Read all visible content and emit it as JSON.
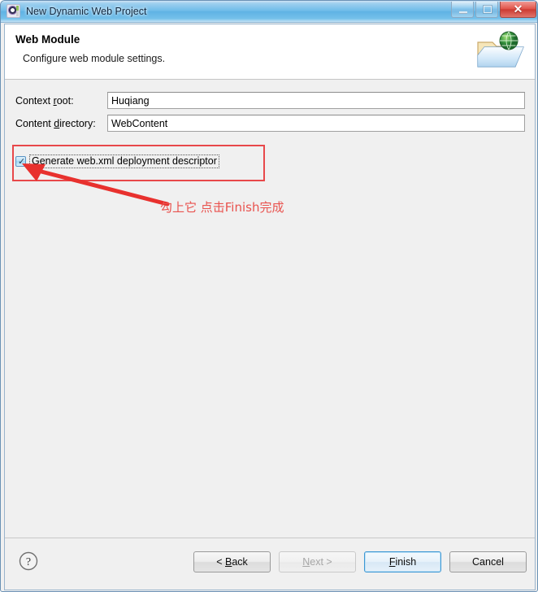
{
  "window": {
    "title": "New Dynamic Web Project",
    "icon": "eclipse-wizard-icon",
    "minimize_label": "Minimize",
    "maximize_label": "Maximize",
    "close_label": "Close",
    "close_glyph": "✕"
  },
  "header": {
    "title": "Web Module",
    "subtitle": "Configure web module settings.",
    "icon": "web-folder-globe-icon"
  },
  "form": {
    "context_root": {
      "label_pre": "Context ",
      "label_mnemonic": "r",
      "label_post": "oot:",
      "value": "Huqiang"
    },
    "content_directory": {
      "label_pre": "Content ",
      "label_mnemonic": "d",
      "label_post": "irectory:",
      "value": "WebContent"
    },
    "generate_webxml": {
      "label_pre": "",
      "label_mnemonic": "G",
      "label_post": "enerate web.xml deployment descriptor",
      "checked": true,
      "check_glyph": "✓"
    }
  },
  "annotation": {
    "text": "勾上它 点击Finish完成",
    "color": "#e9534f",
    "rect_color": "#e8484a",
    "arrow_color": "#e8312e"
  },
  "footer": {
    "help_label": "?",
    "buttons": [
      {
        "name": "back",
        "pre": "< ",
        "mnemonic": "B",
        "post": "ack",
        "state": "enabled"
      },
      {
        "name": "next",
        "pre": "",
        "mnemonic": "N",
        "post": "ext >",
        "state": "disabled"
      },
      {
        "name": "finish",
        "pre": "",
        "mnemonic": "F",
        "post": "inish",
        "state": "default"
      },
      {
        "name": "cancel",
        "pre": "",
        "mnemonic": "",
        "post": "Cancel",
        "state": "enabled"
      }
    ]
  }
}
